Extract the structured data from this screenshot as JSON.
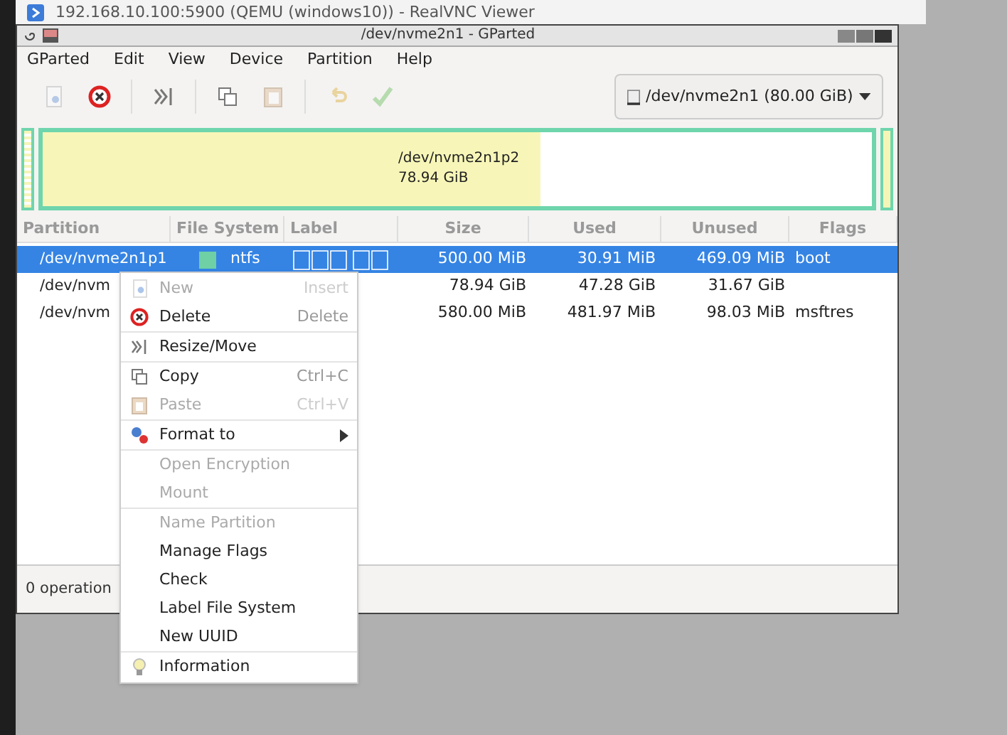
{
  "viewer": {
    "title": "192.168.10.100:5900 (QEMU (windows10)) - RealVNC Viewer"
  },
  "window": {
    "title": "/dev/nvme2n1 - GParted"
  },
  "menubar": [
    "GParted",
    "Edit",
    "View",
    "Device",
    "Partition",
    "Help"
  ],
  "toolbar": [
    {
      "disabled": true
    },
    {
      "disabled": false
    },
    {
      "disabled": false
    },
    {
      "disabled": false
    },
    {
      "disabled": true
    },
    {
      "disabled": true
    },
    {
      "disabled": true
    }
  ],
  "device_selector": {
    "value": "/dev/nvme2n1 (80.00 GiB)"
  },
  "disk_map": {
    "partition": "/dev/nvme2n1p2",
    "size": "78.94 GiB",
    "level": 0.6
  },
  "table": {
    "columns": [
      "Partition",
      "File System",
      "Label",
      "Size",
      "Used",
      "Unused",
      "Flags"
    ],
    "rows": [
      {
        "partition": "/dev/nvme2n1p1",
        "file_system": "ntfs",
        "color": "#6fcfa5",
        "size": "500.00 MiB",
        "used": "30.91 MiB",
        "unused": "469.09 MiB",
        "flags": "boot",
        "selected": true
      },
      {
        "partition": "/dev/nvm",
        "size": "78.94 GiB",
        "used": "47.28 GiB",
        "unused": "31.67 GiB",
        "selected": false
      },
      {
        "partition": "/dev/nvm",
        "size": "580.00 MiB",
        "used": "481.97 MiB",
        "unused": "98.03 MiB",
        "flags": "msftres",
        "selected": false
      }
    ]
  },
  "status_bar": "0 operation",
  "context_menu": [
    {
      "kind": "item",
      "label": "New",
      "shortcut": "Insert",
      "disabled": true
    },
    {
      "kind": "item",
      "label": "Delete",
      "shortcut": "Delete",
      "disabled": false
    },
    {
      "kind": "separator"
    },
    {
      "kind": "item",
      "label": "Resize/Move",
      "disabled": false
    },
    {
      "kind": "separator"
    },
    {
      "kind": "item",
      "label": "Copy",
      "shortcut": "Ctrl+C",
      "disabled": false
    },
    {
      "kind": "item",
      "label": "Paste",
      "shortcut": "Ctrl+V",
      "disabled": true
    },
    {
      "kind": "separator"
    },
    {
      "kind": "submenu",
      "label": "Format to",
      "disabled": false
    },
    {
      "kind": "separator"
    },
    {
      "kind": "item",
      "label": "Open Encryption",
      "disabled": true
    },
    {
      "kind": "item",
      "label": "Mount",
      "disabled": true
    },
    {
      "kind": "separator"
    },
    {
      "kind": "item",
      "label": "Name Partition",
      "disabled": true
    },
    {
      "kind": "item",
      "label": "Manage Flags",
      "disabled": false
    },
    {
      "kind": "item",
      "label": "Check",
      "disabled": false
    },
    {
      "kind": "item",
      "label": "Label File System",
      "disabled": false
    },
    {
      "kind": "item",
      "label": "New UUID",
      "disabled": false
    },
    {
      "kind": "separator"
    },
    {
      "kind": "item",
      "label": "Information",
      "disabled": false
    }
  ]
}
